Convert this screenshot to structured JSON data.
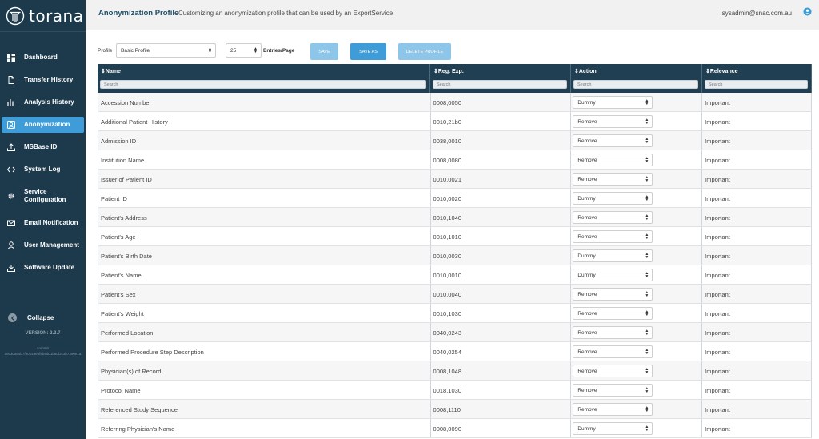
{
  "app": {
    "brand": "torana"
  },
  "sidebar": {
    "items": [
      {
        "label": "Dashboard",
        "icon": "dashboard-icon",
        "active": false
      },
      {
        "label": "Transfer History",
        "icon": "file-icon",
        "active": false
      },
      {
        "label": "Analysis History",
        "icon": "bar-chart-icon",
        "active": false
      },
      {
        "label": "Anonymization",
        "icon": "user-card-icon",
        "active": true
      },
      {
        "label": "MSBase ID",
        "icon": "upload-icon",
        "active": false
      },
      {
        "label": "System Log",
        "icon": "code-icon",
        "active": false
      },
      {
        "label": "Service Configuration",
        "icon": "gear-icon",
        "active": false
      },
      {
        "label": "Email Notification",
        "icon": "mail-icon",
        "active": false
      },
      {
        "label": "User Management",
        "icon": "user-icon",
        "active": false
      },
      {
        "label": "Software Update",
        "icon": "download-icon",
        "active": false
      }
    ],
    "collapse_label": "Collapse",
    "version": "VERSION: 2.3.7",
    "commit_label": "commit",
    "commit_hash": "a6c3d5e4b7f9014ae8f8b9dd1ba0f2c3b7390e1a"
  },
  "header": {
    "title": "Anonymization Profile",
    "subtitle": "Customizing an anonymization profile that can be used by an ExportService",
    "user_email": "sysadmin@snac.com.au"
  },
  "toolbar": {
    "profile_label": "Profile",
    "profile_value": "Basic Profile",
    "entries_value": "25",
    "entries_label": "Entries/Page",
    "save_label": "SAVE",
    "save_as_label": "SAVE AS",
    "delete_label": "DELETE PROFILE"
  },
  "table": {
    "columns": [
      {
        "label": "Name",
        "search_placeholder": "Search"
      },
      {
        "label": "Reg. Exp.",
        "search_placeholder": "Search"
      },
      {
        "label": "Action",
        "search_placeholder": "Search"
      },
      {
        "label": "Relevance",
        "search_placeholder": "Search"
      }
    ],
    "rows": [
      {
        "name": "Accession Number",
        "regexp": "0008,0050",
        "action": "Dummy",
        "relevance": "Important"
      },
      {
        "name": "Additional Patient History",
        "regexp": "0010,21b0",
        "action": "Remove",
        "relevance": "Important"
      },
      {
        "name": "Admission ID",
        "regexp": "0038,0010",
        "action": "Remove",
        "relevance": "Important"
      },
      {
        "name": "Institution Name",
        "regexp": "0008,0080",
        "action": "Remove",
        "relevance": "Important"
      },
      {
        "name": "Issuer of Patient ID",
        "regexp": "0010,0021",
        "action": "Remove",
        "relevance": "Important"
      },
      {
        "name": "Patient ID",
        "regexp": "0010,0020",
        "action": "Dummy",
        "relevance": "Important"
      },
      {
        "name": "Patient's Address",
        "regexp": "0010,1040",
        "action": "Remove",
        "relevance": "Important"
      },
      {
        "name": "Patient's Age",
        "regexp": "0010,1010",
        "action": "Remove",
        "relevance": "Important"
      },
      {
        "name": "Patient's Birth Date",
        "regexp": "0010,0030",
        "action": "Dummy",
        "relevance": "Important"
      },
      {
        "name": "Patient's Name",
        "regexp": "0010,0010",
        "action": "Dummy",
        "relevance": "Important"
      },
      {
        "name": "Patient's Sex",
        "regexp": "0010,0040",
        "action": "Remove",
        "relevance": "Important"
      },
      {
        "name": "Patient's Weight",
        "regexp": "0010,1030",
        "action": "Remove",
        "relevance": "Important"
      },
      {
        "name": "Performed Location",
        "regexp": "0040,0243",
        "action": "Remove",
        "relevance": "Important"
      },
      {
        "name": "Performed Procedure Step Description",
        "regexp": "0040,0254",
        "action": "Remove",
        "relevance": "Important"
      },
      {
        "name": "Physician(s) of Record",
        "regexp": "0008,1048",
        "action": "Remove",
        "relevance": "Important"
      },
      {
        "name": "Protocol Name",
        "regexp": "0018,1030",
        "action": "Remove",
        "relevance": "Important"
      },
      {
        "name": "Referenced Study Sequence",
        "regexp": "0008,1110",
        "action": "Remove",
        "relevance": "Important"
      },
      {
        "name": "Referring Physician's Name",
        "regexp": "0008,0090",
        "action": "Dummy",
        "relevance": "Important"
      }
    ]
  },
  "colors": {
    "sidebar_bg": "#1d3a4d",
    "accent": "#3e9dd8",
    "table_header": "#213f52",
    "title": "#1f4f6b"
  }
}
